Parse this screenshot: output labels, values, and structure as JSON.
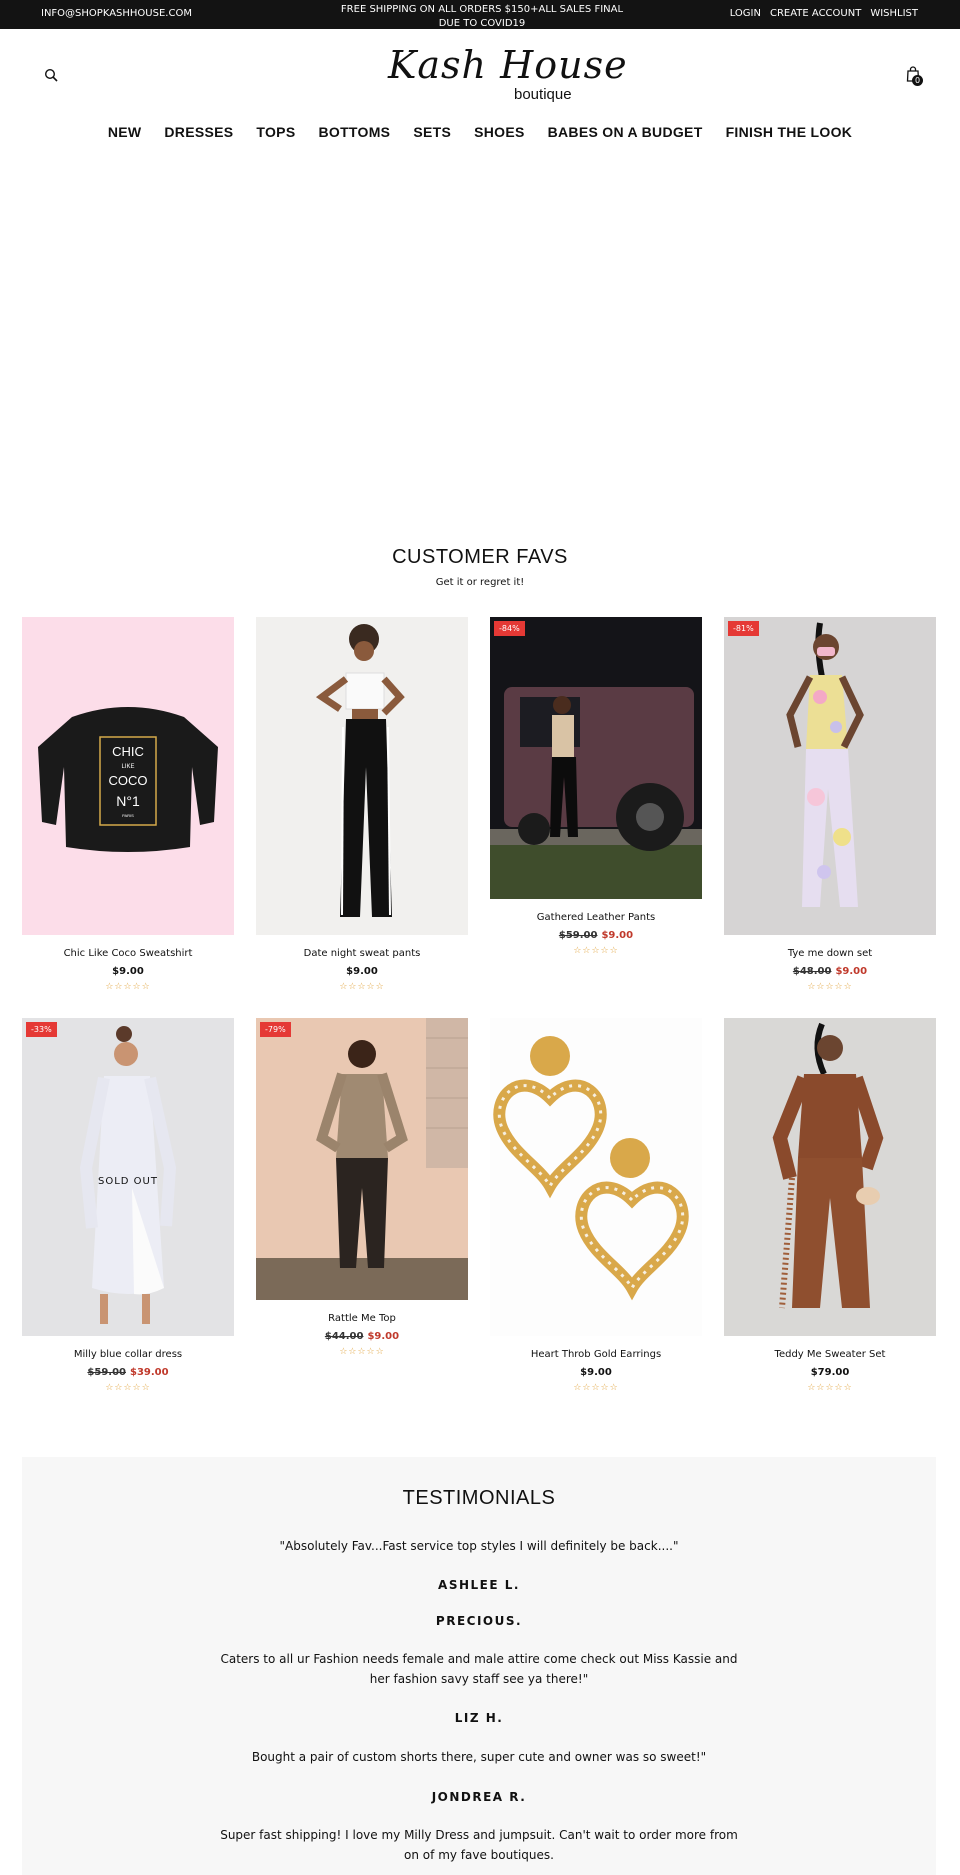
{
  "topbar": {
    "email": "INFO@SHOPKASHHOUSE.COM",
    "promo": "FREE SHIPPING ON ALL ORDERS $150+ALL SALES FINAL DUE TO COVID19",
    "login": "LOGIN",
    "create_account": "CREATE ACCOUNT",
    "wishlist": "WISHLIST"
  },
  "header": {
    "logo_script": "Kash House",
    "logo_sub": "boutique",
    "cart_count": "0"
  },
  "nav": [
    "NEW",
    "DRESSES",
    "TOPS",
    "BOTTOMS",
    "SETS",
    "SHOES",
    "BABES ON A BUDGET",
    "FINISH THE LOOK"
  ],
  "section": {
    "title": "CUSTOMER FAVS",
    "subtitle": "Get it or regret it!"
  },
  "products": [
    {
      "name": "Chic Like Coco Sweatshirt",
      "price": "$9.00",
      "old_price": "",
      "new_price": "",
      "badge": "",
      "sold_out": "",
      "rating_stars": "☆☆☆☆☆",
      "sweatshirt_text": [
        "CHIC",
        "LIKE",
        "COCO",
        "N°1",
        "PARIS"
      ]
    },
    {
      "name": "Date night sweat pants",
      "price": "$9.00",
      "old_price": "",
      "new_price": "",
      "badge": "",
      "sold_out": "",
      "rating_stars": "☆☆☆☆☆"
    },
    {
      "name": "Gathered Leather Pants",
      "price": "",
      "old_price": "$59.00",
      "new_price": "$9.00",
      "badge": "-84%",
      "sold_out": "",
      "rating_stars": "☆☆☆☆☆"
    },
    {
      "name": "Tye me down set",
      "price": "",
      "old_price": "$48.00",
      "new_price": "$9.00",
      "badge": "-81%",
      "sold_out": "",
      "rating_stars": "☆☆☆☆☆"
    },
    {
      "name": "Milly blue collar dress",
      "price": "",
      "old_price": "$59.00",
      "new_price": "$39.00",
      "badge": "-33%",
      "sold_out": "SOLD OUT",
      "rating_stars": "☆☆☆☆☆"
    },
    {
      "name": "Rattle Me Top",
      "price": "",
      "old_price": "$44.00",
      "new_price": "$9.00",
      "badge": "-79%",
      "sold_out": "",
      "rating_stars": "☆☆☆☆☆"
    },
    {
      "name": "Heart Throb Gold Earrings",
      "price": "$9.00",
      "old_price": "",
      "new_price": "",
      "badge": "",
      "sold_out": "",
      "rating_stars": "☆☆☆☆☆"
    },
    {
      "name": "Teddy Me Sweater Set",
      "price": "$79.00",
      "old_price": "",
      "new_price": "",
      "badge": "",
      "sold_out": "",
      "rating_stars": "☆☆☆☆☆"
    }
  ],
  "testimonials": {
    "title": "TESTIMONIALS",
    "items": [
      {
        "quote": "\"Absolutely Fav...Fast service top styles I will definitely be back....\"",
        "author": "ASHLEE L."
      },
      {
        "quote": "",
        "author": "PRECIOUS."
      },
      {
        "quote": "Caters to all ur Fashion needs female and male attire come check out Miss Kassie and her fashion savy staff see ya there!\"",
        "author": "LIZ H."
      },
      {
        "quote": "Bought a pair of custom shorts there, super cute and owner was so sweet!\"",
        "author": "JONDREA R."
      },
      {
        "quote": "Super fast shipping! I love my Milly Dress and jumpsuit. Can't wait to order more from on of my fave boutiques.",
        "author": ""
      }
    ]
  },
  "colors": {
    "topbar_bg": "#131313",
    "sale_badge": "#e53935",
    "sale_price": "#c0392b",
    "stars": "#e0a23a",
    "testimonial_bg": "#f7f7f7"
  },
  "icons": [
    "search-icon",
    "shopping-bag-icon",
    "star-icon"
  ]
}
